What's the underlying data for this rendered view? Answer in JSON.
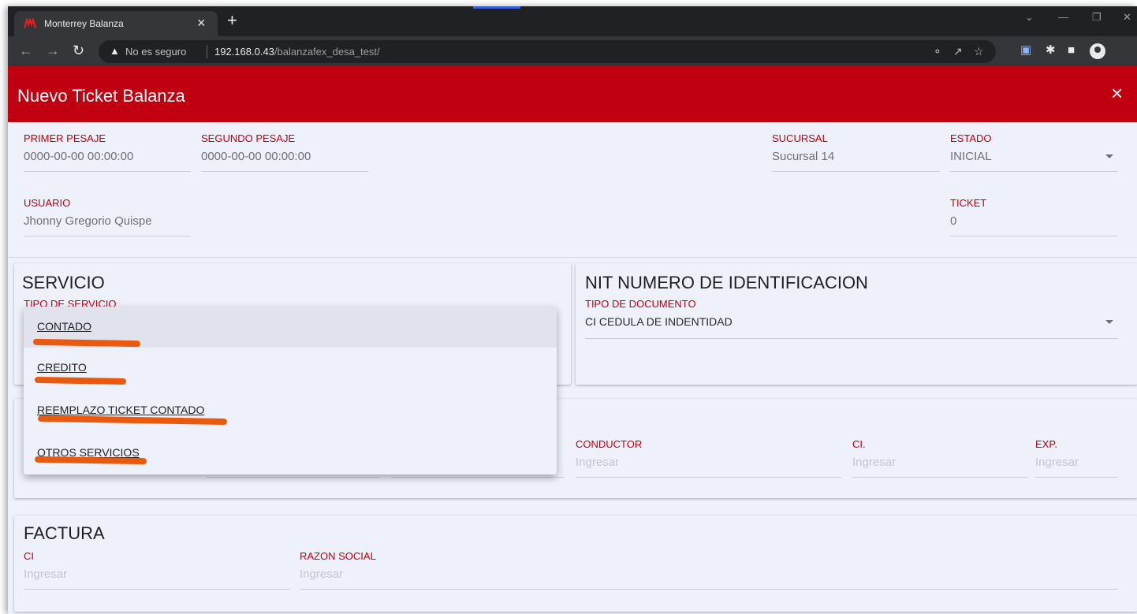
{
  "browser": {
    "tab_title": "Monterrey Balanza",
    "tab_close": "×",
    "new_tab": "+",
    "security_label": "No es seguro",
    "url_host": "192.168.0.43",
    "url_path": "/balanzafex_desa_test/",
    "icons": [
      "back-arrow-icon",
      "forward-arrow-icon",
      "reload-icon",
      "warning-icon",
      "key-icon",
      "share-icon",
      "star-icon",
      "extension-icon",
      "puzzle-icon",
      "sidepanel-icon",
      "profile-icon"
    ]
  },
  "app": {
    "title": "Nuevo Ticket Balanza",
    "close": "×",
    "brand_color": "#c00010"
  },
  "header_fields": {
    "primer_pesaje": {
      "label": "PRIMER PESAJE",
      "value": "0000-00-00 00:00:00"
    },
    "segundo_pesaje": {
      "label": "SEGUNDO PESAJE",
      "value": "0000-00-00 00:00:00"
    },
    "sucursal": {
      "label": "SUCURSAL",
      "value": "Sucursal 14"
    },
    "estado": {
      "label": "ESTADO",
      "value": "INICIAL"
    },
    "usuario": {
      "label": "USUARIO",
      "value": "Jhonny Gregorio Quispe"
    },
    "ticket": {
      "label": "TICKET",
      "value": "0"
    }
  },
  "servicio": {
    "title": "SERVICIO",
    "tipo_label": "TIPO DE SERVICIO",
    "options": [
      "CONTADO",
      "CREDITO",
      "REEMPLAZO TICKET CONTADO",
      "OTROS SERVICIOS"
    ]
  },
  "nit": {
    "title": "NIT NUMERO DE IDENTIFICACION",
    "tipo_label": "TIPO DE DOCUMENTO",
    "tipo_value": "CI CEDULA DE INDENTIDAD"
  },
  "conductor_section": {
    "conductor": {
      "label": "CONDUCTOR",
      "placeholder": "Ingresar"
    },
    "ci": {
      "label": "CI.",
      "placeholder": "Ingresar"
    },
    "exp": {
      "label": "EXP.",
      "placeholder": "Ingresar"
    }
  },
  "factura": {
    "title": "FACTURA",
    "ci": {
      "label": "CI",
      "placeholder": "Ingresar"
    },
    "razon_social": {
      "label": "RAZON SOCIAL",
      "placeholder": "Ingresar"
    }
  }
}
